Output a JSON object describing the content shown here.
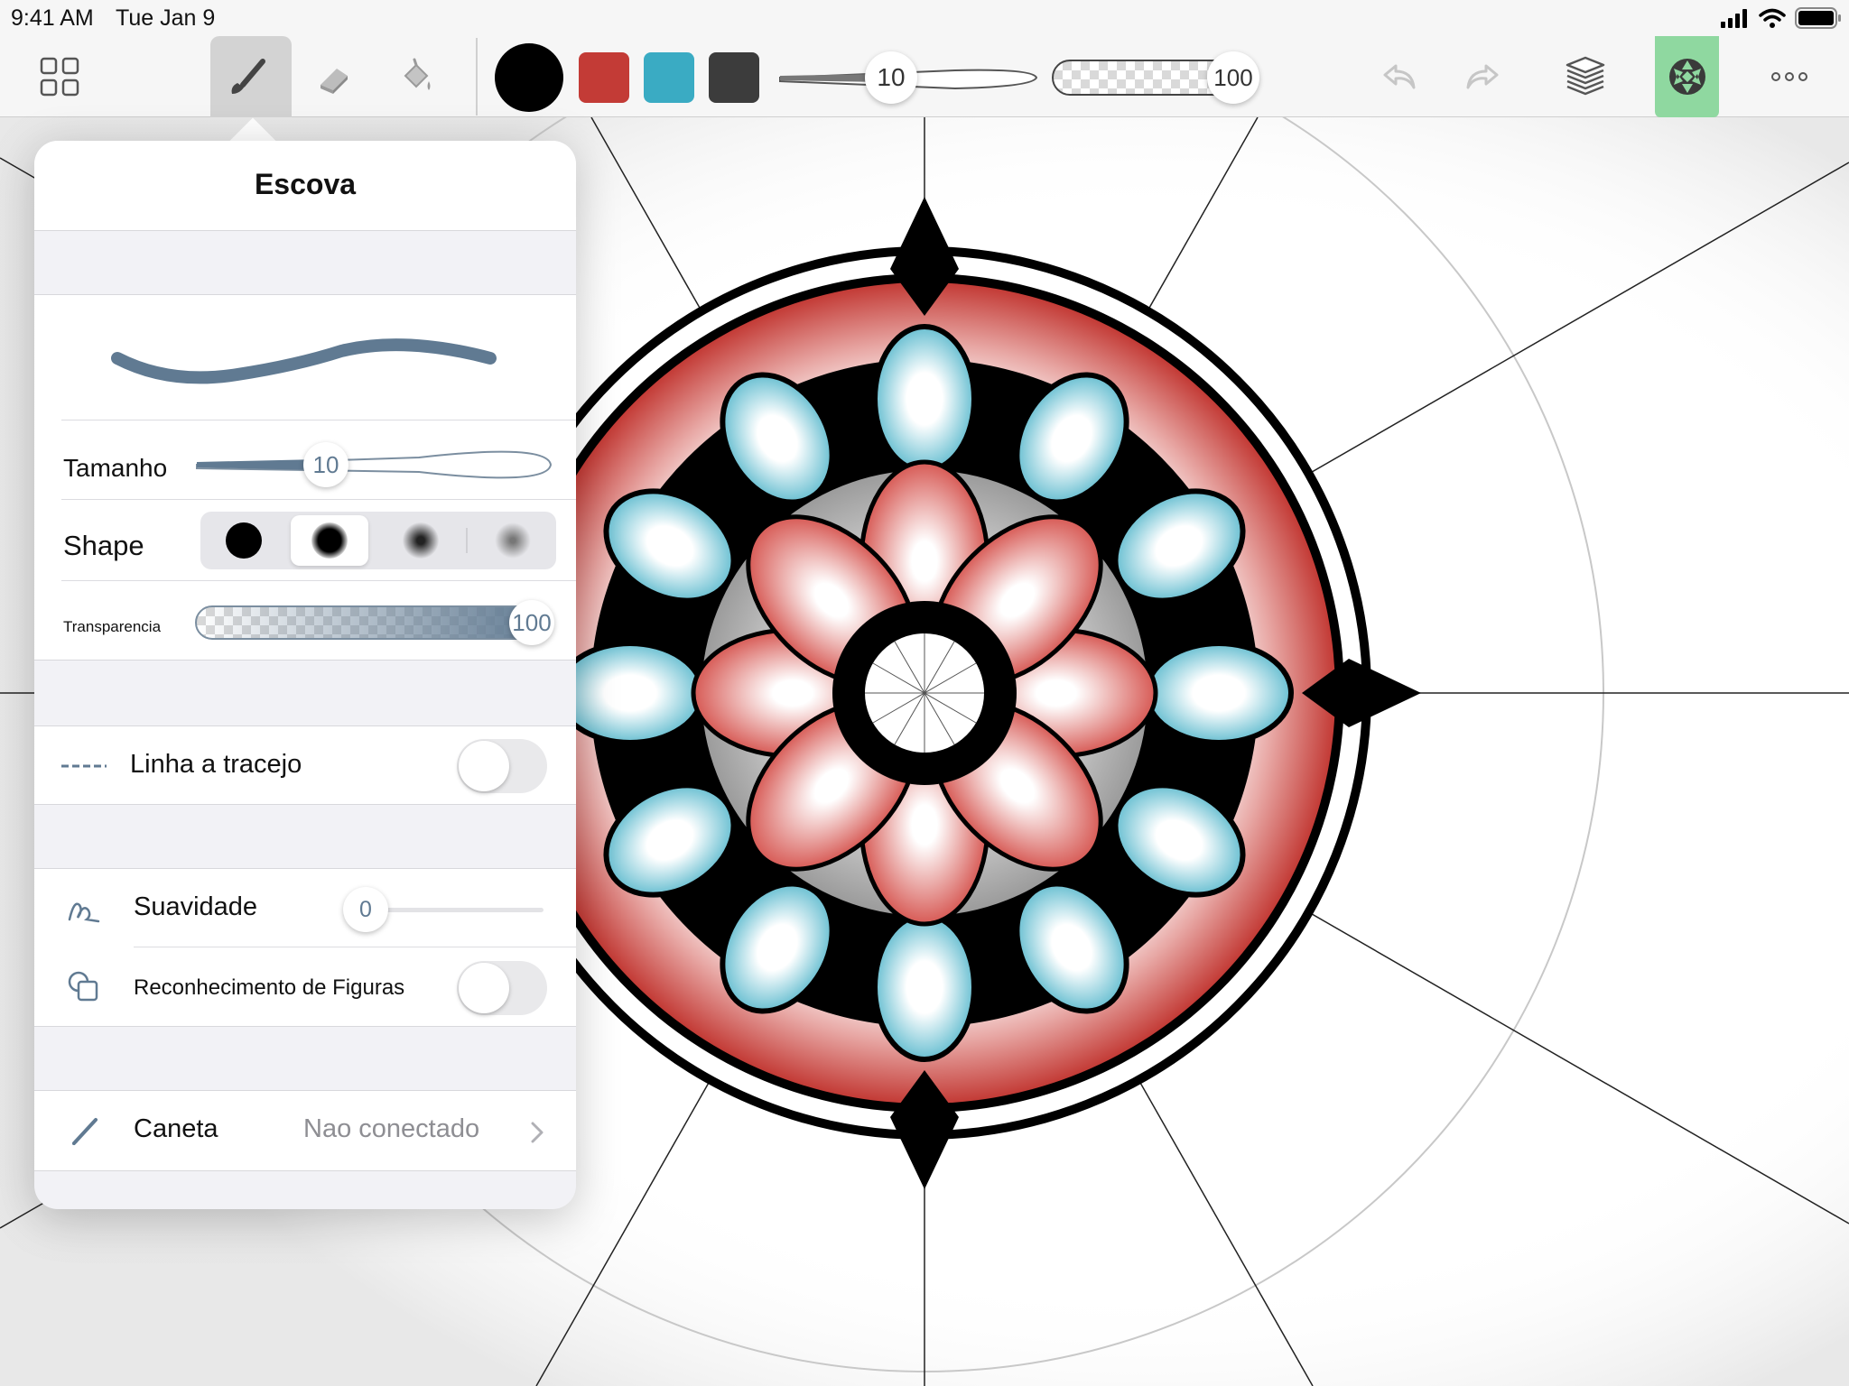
{
  "status_bar": {
    "time": "9:41 AM",
    "date": "Tue Jan 9"
  },
  "toolbar": {
    "colors": [
      "#000000",
      "#c33b36",
      "#3aabc3",
      "#3c3c3c"
    ],
    "size_value": "10",
    "opacity_value": "100",
    "accent": "#8fd8a0"
  },
  "panel": {
    "title": "Escova",
    "size_label": "Tamanho",
    "size_value": "10",
    "shape_label": "Shape",
    "opacity_label": "Transparencia",
    "opacity_value": "100",
    "dashed_label": "Linha a tracejo",
    "smooth_label": "Suavidade",
    "smooth_value": "0",
    "shape_recognition_label": "Reconhecimento de Figuras",
    "pen_label": "Caneta",
    "pen_status": "Nao conectado"
  }
}
